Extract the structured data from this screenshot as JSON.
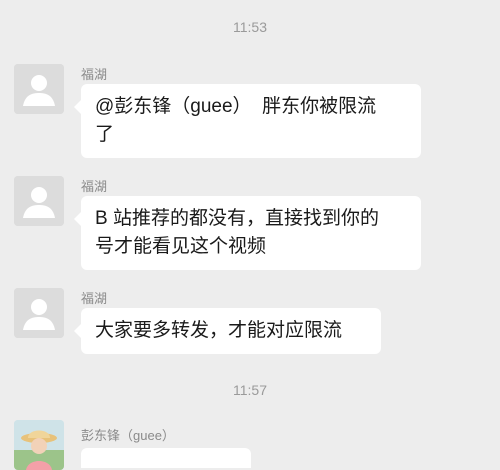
{
  "chat": {
    "timestamps": [
      "11:53",
      "11:57"
    ],
    "messages": [
      {
        "sender": "福湖",
        "avatar_icon": "default-user-icon",
        "text": "@彭东锋（guee）  胖东你被限流\n了"
      },
      {
        "sender": "福湖",
        "avatar_icon": "default-user-icon",
        "text": "B 站推荐的都没有，直接找到你的\n号才能看见这个视频"
      },
      {
        "sender": "福湖",
        "avatar_icon": "default-user-icon",
        "text": "大家要多转发，才能对应限流"
      },
      {
        "sender": "彭东锋（guee）",
        "avatar_icon": "photo-avatar-icon",
        "text": ""
      }
    ]
  },
  "colors": {
    "background": "#ededed",
    "bubble": "#ffffff",
    "meta_text": "#9a9a9a"
  }
}
